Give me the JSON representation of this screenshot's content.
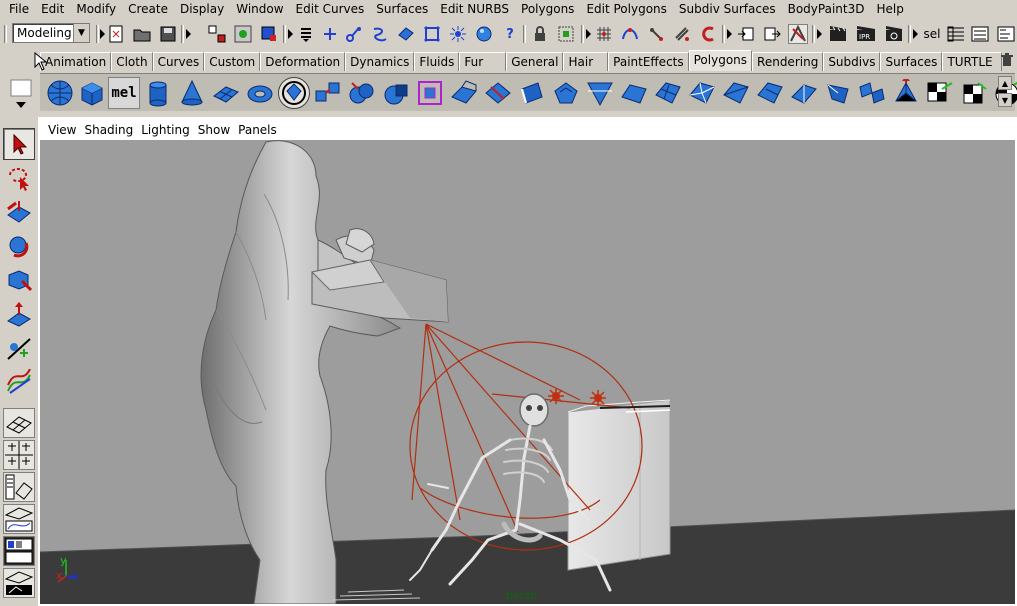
{
  "menubar": {
    "items": [
      "File",
      "Edit",
      "Modify",
      "Create",
      "Display",
      "Window",
      "Edit Curves",
      "Surfaces",
      "Edit NURBS",
      "Polygons",
      "Edit Polygons",
      "Subdiv Surfaces",
      "BodyPaint3D",
      "Help"
    ]
  },
  "statusline": {
    "mode": "Modeling",
    "sel_label": "sel"
  },
  "shelf_tabs": [
    "Animation",
    "Cloth",
    "Curves",
    "Custom",
    "Deformation",
    "Dynamics",
    "Fluids",
    "Fur",
    "General",
    "Hair",
    "PaintEffects",
    "Polygons",
    "Rendering",
    "Subdivs",
    "Surfaces",
    "TURTLE"
  ],
  "shelf_active_tab": "Polygons",
  "shelf": {
    "mel_label": "mel"
  },
  "panel": {
    "menu": [
      "View",
      "Shading",
      "Lighting",
      "Show",
      "Panels"
    ],
    "camera_label": "persp",
    "axis": {
      "x": "x",
      "y": "y",
      "z": "z"
    }
  },
  "colors": {
    "ui_gray": "#d4d0c8",
    "viewport_bg": "#9d9d9d",
    "floor": "#3a3a3a",
    "light_manipulator": "#b03010",
    "icon_blue": "#1f6fd0"
  }
}
